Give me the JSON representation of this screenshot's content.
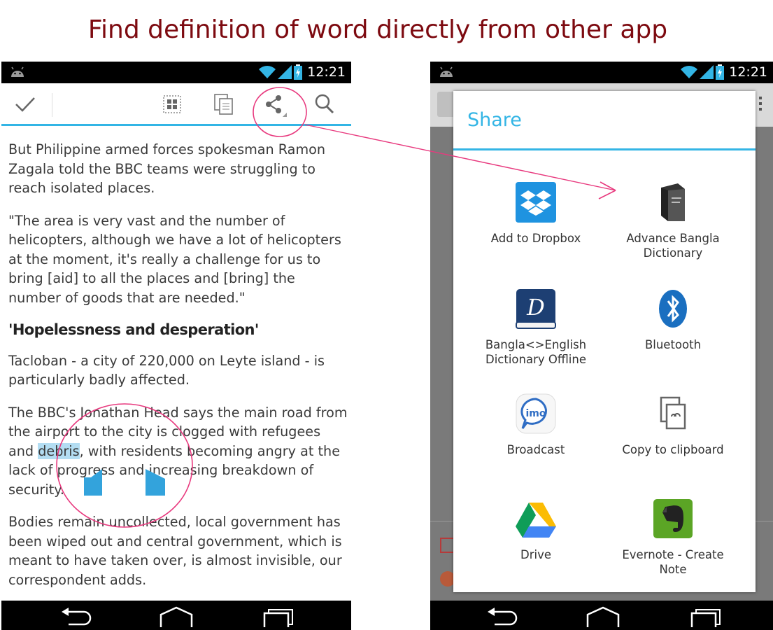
{
  "headline": "Find definition of word directly from other app",
  "status": {
    "time": "12:21"
  },
  "article": {
    "p1": "But Philippine armed forces spokesman Ramon Zagala told the BBC teams were struggling to reach isolated places.",
    "p2": "\"The area is very vast and the number of helicopters, although we have a lot of helicopters at the moment, it's really a challenge for us to bring [aid] to all the places and [bring] the number of goods that are needed.\"",
    "heading": "'Hopelessness and desperation'",
    "p3": "Tacloban - a city of 220,000 on Leyte island - is particularly badly affected.",
    "p4_before": "The BBC's Jonathan Head says the main road from the airport to the city is clogged with refugees and ",
    "p4_selected": "debris",
    "p4_after": ", with residents becoming angry at the lack of progress and increasing breakdown of security.",
    "p5": "Bodies remain uncollected, local government has been wiped out and central government, which is meant to have taken over, is almost invisible, our correspondent adds."
  },
  "share_dialog": {
    "title": "Share",
    "items": [
      {
        "label": "Add to Dropbox",
        "icon": "dropbox-icon"
      },
      {
        "label": "Advance Bangla Dictionary",
        "icon": "book-icon"
      },
      {
        "label": "Bangla<>English Dictionary Offline",
        "icon": "dictionary-icon"
      },
      {
        "label": "Bluetooth",
        "icon": "bluetooth-icon"
      },
      {
        "label": "Broadcast",
        "icon": "imo-icon"
      },
      {
        "label": "Copy to clipboard",
        "icon": "clipboard-icon"
      },
      {
        "label": "Drive",
        "icon": "drive-icon"
      },
      {
        "label": "Evernote - Create Note",
        "icon": "evernote-icon"
      }
    ]
  },
  "colors": {
    "accent": "#33b5e5",
    "headline": "#7d0a10",
    "annotation": "#e8397e",
    "selection": "#b3ddf2"
  }
}
